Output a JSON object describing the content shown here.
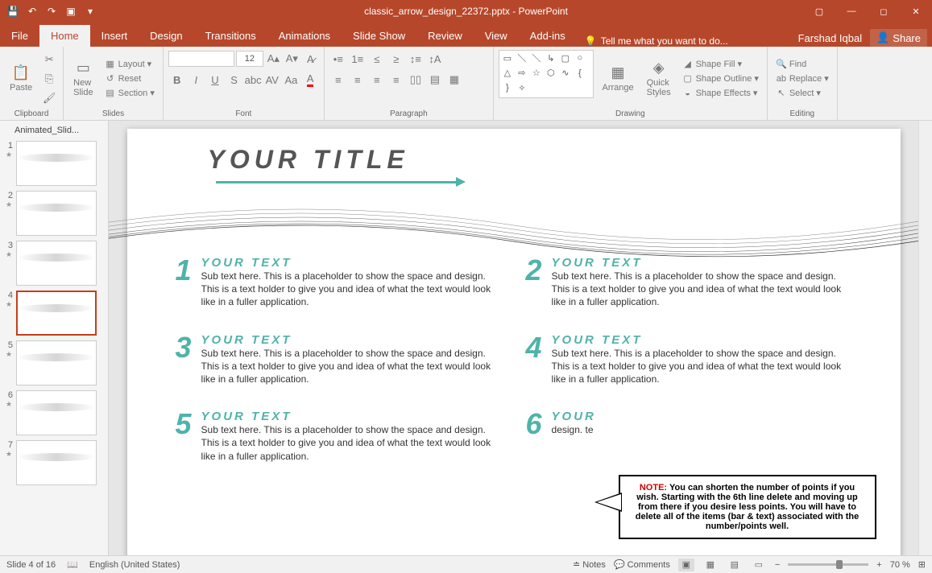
{
  "titlebar": {
    "filename": "classic_arrow_design_22372.pptx - PowerPoint"
  },
  "tabs": {
    "file": "File",
    "home": "Home",
    "insert": "Insert",
    "design": "Design",
    "transitions": "Transitions",
    "animations": "Animations",
    "slideshow": "Slide Show",
    "review": "Review",
    "view": "View",
    "addins": "Add-ins",
    "tellme": "Tell me what you want to do...",
    "user": "Farshad Iqbal",
    "share": "Share"
  },
  "ribbon": {
    "clipboard": {
      "label": "Clipboard",
      "paste": "Paste"
    },
    "slides": {
      "label": "Slides",
      "new_slide": "New\nSlide",
      "layout": "Layout",
      "reset": "Reset",
      "section": "Section"
    },
    "font": {
      "label": "Font",
      "size": "12"
    },
    "paragraph": {
      "label": "Paragraph"
    },
    "drawing": {
      "label": "Drawing",
      "arrange": "Arrange",
      "quick_styles": "Quick\nStyles",
      "shape_fill": "Shape Fill",
      "shape_outline": "Shape Outline",
      "shape_effects": "Shape Effects"
    },
    "editing": {
      "label": "Editing",
      "find": "Find",
      "replace": "Replace",
      "select": "Select"
    }
  },
  "thumbs": {
    "header": "Animated_Slid...",
    "items": [
      "1",
      "2",
      "3",
      "4",
      "5",
      "6",
      "7"
    ]
  },
  "slide": {
    "title": "YOUR TITLE",
    "points": [
      {
        "n": "1",
        "t": "YOUR TEXT",
        "b": "Sub text here. This is a placeholder to show the space and design. This is a text holder to give you and idea of what the text would look like in a fuller application."
      },
      {
        "n": "2",
        "t": "YOUR TEXT",
        "b": "Sub text here. This is a placeholder to show the space and design. This is a text holder to give you and idea of what the text would look like in a fuller application."
      },
      {
        "n": "3",
        "t": "YOUR TEXT",
        "b": "Sub text here. This is a placeholder to show the space and design. This is a text holder to give you and idea of what the text would look like in a fuller application."
      },
      {
        "n": "4",
        "t": "YOUR TEXT",
        "b": "Sub text here. This is a placeholder to show the space and design. This is a text holder to give you and idea of what the text would look like in a fuller application."
      },
      {
        "n": "5",
        "t": "YOUR TEXT",
        "b": "Sub text here. This is a placeholder to show the space and design. This is a text holder to give you and idea of what the text would look like in a fuller application."
      },
      {
        "n": "6",
        "t": "YOUR",
        "b": "design.\nte"
      }
    ],
    "note_label": "NOTE:",
    "note_text": " You can shorten the number of points if you wish. Starting with the 6th line delete and moving up from there if you desire less points. You will have to delete all of the items (bar & text) associated with the number/points well."
  },
  "status": {
    "slide": "Slide 4 of 16",
    "lang": "English (United States)",
    "notes": "Notes",
    "comments": "Comments",
    "zoom": "70 %"
  }
}
